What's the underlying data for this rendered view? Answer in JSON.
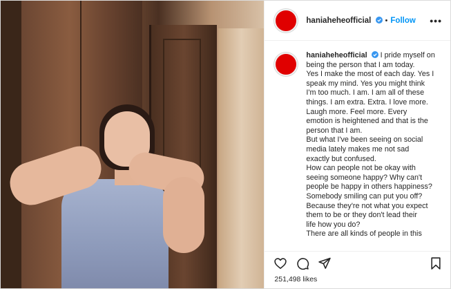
{
  "post": {
    "username": "haniaheheofficial",
    "follow_label": "Follow",
    "separator": "•",
    "more_label": "•••",
    "caption_lines": [
      "I pride myself on",
      "being the person that I am today.",
      "Yes I make the most of each day. Yes I",
      "speak my mind. Yes you might think",
      "I'm too much. I am. I am all of these",
      "things. I am extra. Extra. I love more.",
      "Laugh more. Feel more. Every",
      "emotion is heightened and that is the",
      "person that I am.",
      "But what I've been seeing on social",
      "media lately makes me not sad",
      "exactly but confused.",
      "How can people not be okay with",
      "seeing someone happy? Why can't",
      "people be happy in others happiness?",
      "Somebody smiling can put you off?",
      "Because they're not what you expect",
      "them to be or they don't lead their",
      "life how you do?",
      "There are all kinds of people in this"
    ],
    "likes": "251,498 likes"
  },
  "icons": {
    "verified": "verified-badge-icon",
    "like": "heart-icon",
    "comment": "comment-icon",
    "share": "share-icon",
    "save": "bookmark-icon"
  },
  "colors": {
    "avatar": "#e00000",
    "follow": "#0095f6",
    "verified": "#3897f0"
  }
}
